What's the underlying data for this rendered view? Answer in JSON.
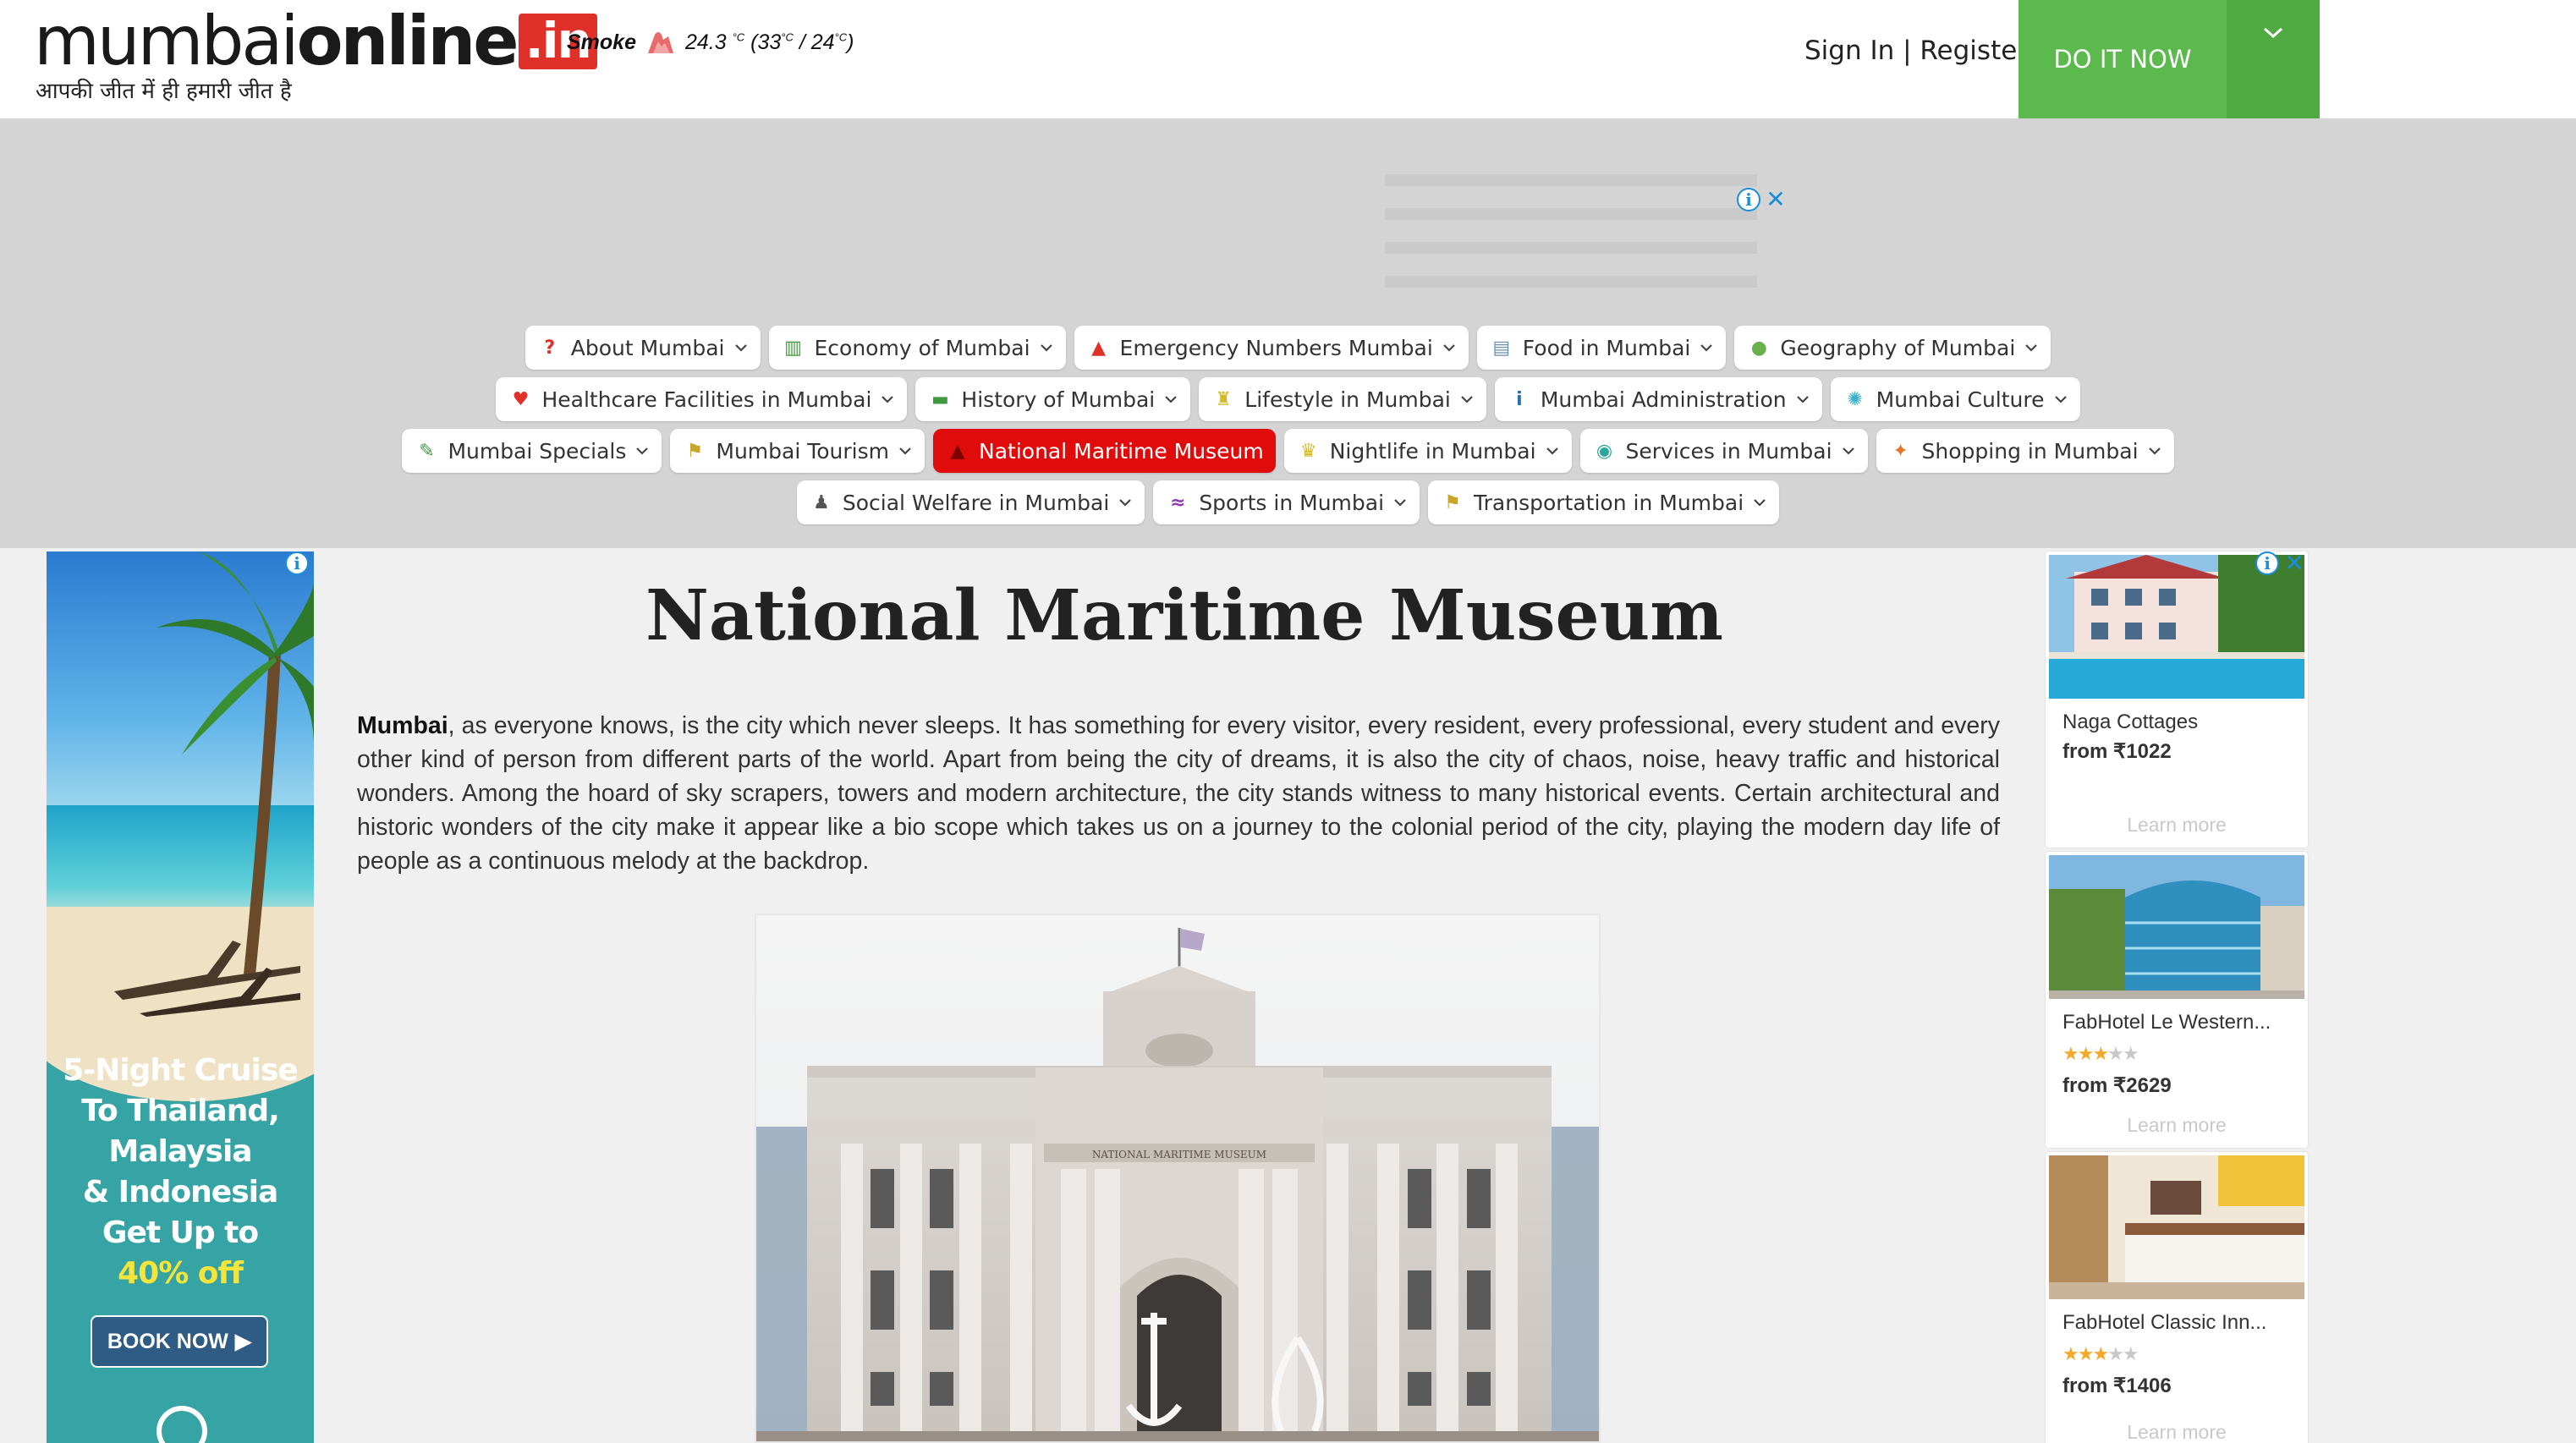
{
  "header": {
    "logo": {
      "part1": "mumbai",
      "part2": "online",
      "tld": ".in"
    },
    "tagline": "आपकी जीत में ही हमारी जीत है",
    "weather": {
      "condition": "Smoke",
      "temp": "24.3",
      "unit": "°C",
      "range_prefix": "(33",
      "range_mid": " / 24",
      "range_suffix": ")"
    },
    "signin": "Sign In | Register",
    "cta": "DO IT NOW"
  },
  "nav": {
    "rows": [
      [
        {
          "label": "About Mumbai",
          "icon": "question-icon",
          "color": "#e0302a"
        },
        {
          "label": "Economy of Mumbai",
          "icon": "bar-chart-icon",
          "color": "#3c9a3c"
        },
        {
          "label": "Emergency Numbers Mumbai",
          "icon": "siren-icon",
          "color": "#e0302a"
        },
        {
          "label": "Food in Mumbai",
          "icon": "food-tray-icon",
          "color": "#6a8fb5"
        },
        {
          "label": "Geography of Mumbai",
          "icon": "globe-icon",
          "color": "#6ab04c"
        }
      ],
      [
        {
          "label": "Healthcare Facilities in Mumbai",
          "icon": "heart-icon",
          "color": "#e0302a"
        },
        {
          "label": "History of Mumbai",
          "icon": "book-icon",
          "color": "#3c9a3c"
        },
        {
          "label": "Lifestyle in Mumbai",
          "icon": "lifestyle-icon",
          "color": "#d4b92a"
        },
        {
          "label": "Mumbai Administration",
          "icon": "info-icon",
          "color": "#2a6fb0"
        },
        {
          "label": "Mumbai Culture",
          "icon": "sparkle-icon",
          "color": "#3cb0c9"
        }
      ],
      [
        {
          "label": "Mumbai Specials",
          "icon": "wand-icon",
          "color": "#3c9a3c"
        },
        {
          "label": "Mumbai Tourism",
          "icon": "signpost-icon",
          "color": "#c9a62a"
        },
        {
          "label": "National Maritime Museum",
          "icon": "bell-icon",
          "color": "#8a0000",
          "active": true
        },
        {
          "label": "Nightlife in Mumbai",
          "icon": "drink-icon",
          "color": "#d4b92a"
        },
        {
          "label": "Services in Mumbai",
          "icon": "service-icon",
          "color": "#2aa89a"
        },
        {
          "label": "Shopping in Mumbai",
          "icon": "shopping-icon",
          "color": "#e07a2a"
        }
      ],
      [
        {
          "label": "Social Welfare in Mumbai",
          "icon": "person-icon",
          "color": "#555555"
        },
        {
          "label": "Sports in Mumbai",
          "icon": "swim-icon",
          "color": "#8a3cb0"
        },
        {
          "label": "Transportation in Mumbai",
          "icon": "transport-sign-icon",
          "color": "#c9a62a"
        }
      ]
    ]
  },
  "article": {
    "title": "National Maritime Museum",
    "lead_bold": "Mumbai",
    "lead_rest": ", as everyone knows, is the city which never sleeps. It has something for every visitor, every resident, every professional, every student and every other kind of person from different parts of the world. Apart from being the city of dreams, it is also the city of chaos, noise, heavy traffic and historical wonders. Among the hoard of sky scrapers, towers and modern architecture, the city stands witness to many historical events. Certain architectural and historic wonders of the city make it appear like a bio scope which takes us on a journey to the colonial period of the city, playing the modern day life of people as a continuous melody at the backdrop.",
    "photo_caption_sign": "NATIONAL MARITIME MUSEUM"
  },
  "left_ad": {
    "lines": [
      "5-Night Cruise",
      "To Thailand,",
      "Malaysia",
      "& Indonesia",
      "Get Up to"
    ],
    "highlight": "40% off",
    "button": "BOOK NOW"
  },
  "right_ads": [
    {
      "name": "Naga Cottages",
      "price": "from ₹1022",
      "stars": 0,
      "learn": "Learn more"
    },
    {
      "name": "FabHotel Le Western...",
      "price": "from ₹2629",
      "stars": 3,
      "learn": "Learn more"
    },
    {
      "name": "FabHotel Classic Inn...",
      "price": "from ₹1406",
      "stars": 3,
      "learn": "Learn more"
    }
  ],
  "colors": {
    "accent_green": "#5cb94d",
    "active_nav": "#e00b0b",
    "ad_blue": "#1a8fd9"
  }
}
